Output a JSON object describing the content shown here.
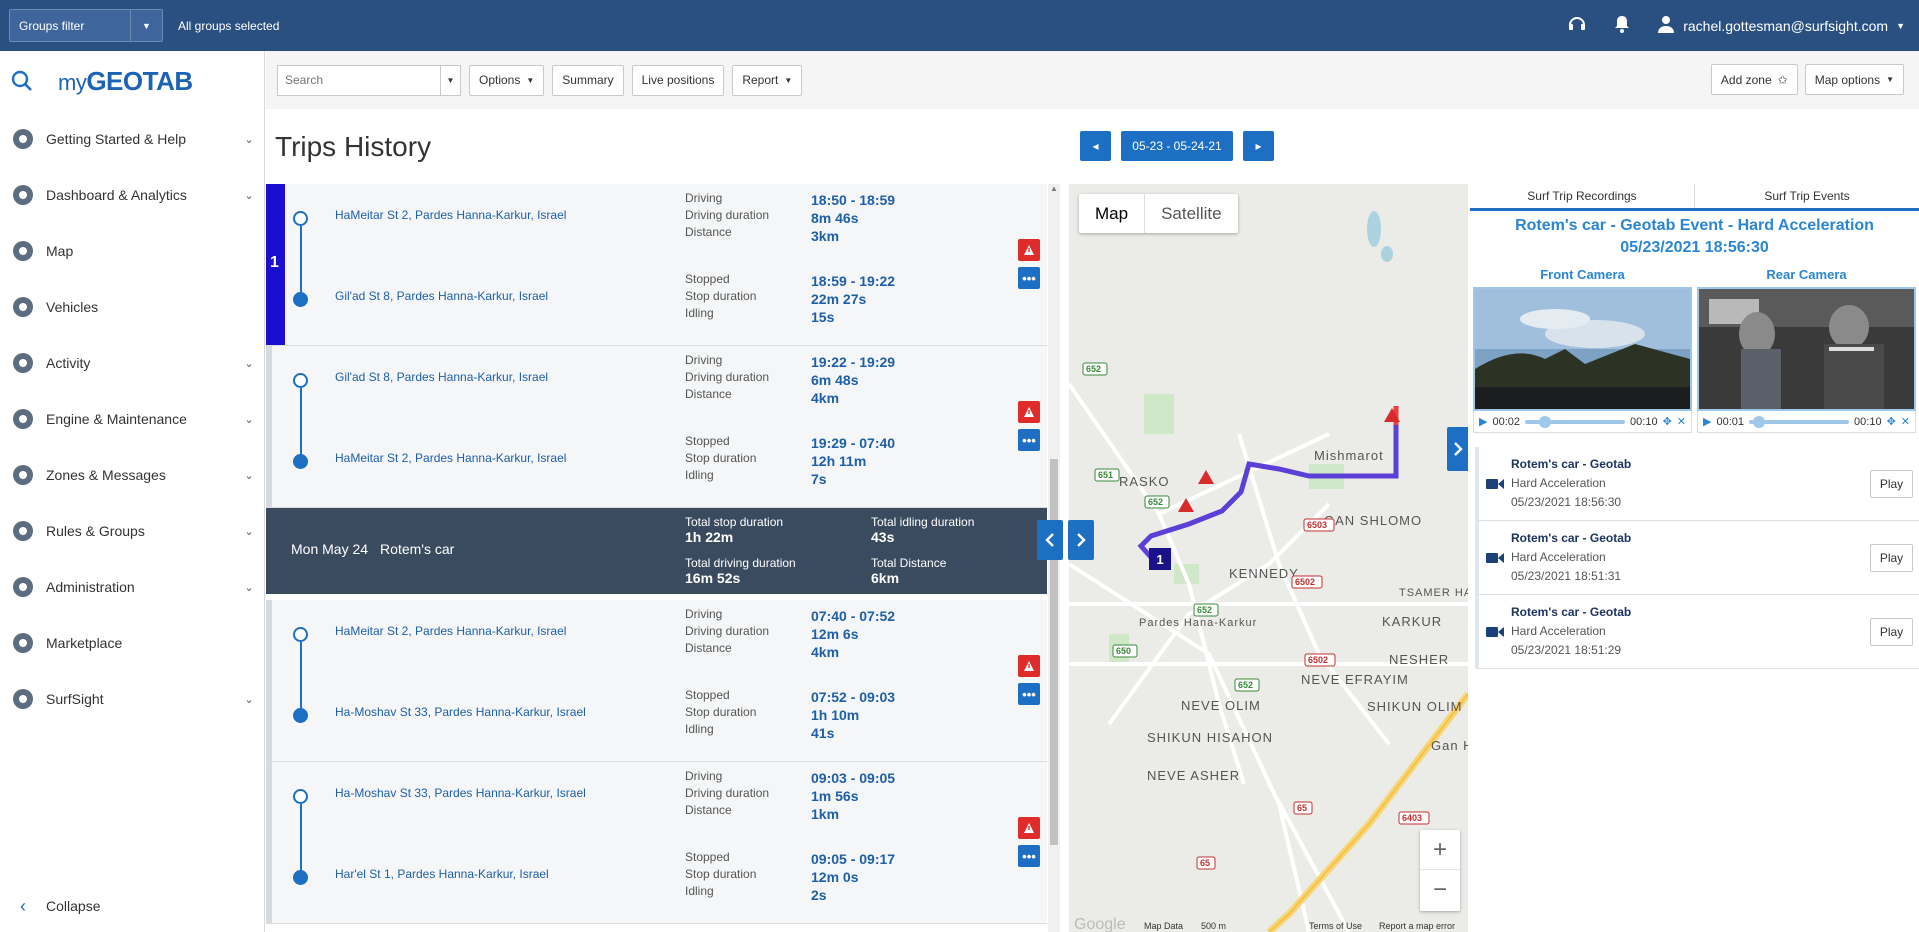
{
  "topbar": {
    "groups_filter": "Groups filter",
    "groups_selected": "All groups selected",
    "user": "rachel.gottesman@surfsight.com"
  },
  "sidebar": {
    "logo_my": "my",
    "logo_brand": "GEOTAB",
    "items": [
      {
        "label": "Getting Started & Help",
        "icon": "help-icon"
      },
      {
        "label": "Dashboard & Analytics",
        "icon": "pie-chart-icon"
      },
      {
        "label": "Map",
        "icon": "map-icon"
      },
      {
        "label": "Vehicles",
        "icon": "truck-icon"
      },
      {
        "label": "Activity",
        "icon": "bar-chart-icon"
      },
      {
        "label": "Engine & Maintenance",
        "icon": "engine-icon"
      },
      {
        "label": "Zones & Messages",
        "icon": "zones-icon"
      },
      {
        "label": "Rules & Groups",
        "icon": "rules-icon"
      },
      {
        "label": "Administration",
        "icon": "gear-icon"
      },
      {
        "label": "Marketplace",
        "icon": "marketplace-icon"
      },
      {
        "label": "SurfSight",
        "icon": "puzzle-icon"
      }
    ],
    "collapse": "Collapse"
  },
  "toolbar": {
    "search_placeholder": "Search",
    "options": "Options",
    "summary": "Summary",
    "live_positions": "Live positions",
    "report": "Report",
    "add_zone": "Add zone",
    "map_options": "Map options"
  },
  "page": {
    "title": "Trips History",
    "date_range": "05-23 - 05-24-21"
  },
  "trips": [
    {
      "number": "1",
      "from": "HaMeitar St 2, Pardes Hanna-Karkur, Israel",
      "to": "Gil'ad St 8, Pardes Hanna-Karkur, Israel",
      "k1": [
        "Driving",
        "Driving duration",
        "Distance"
      ],
      "v1": [
        "18:50 - 18:59",
        "8m 46s",
        "3km"
      ],
      "k2": [
        "Stopped",
        "Stop duration",
        "Idling"
      ],
      "v2": [
        "18:59 - 19:22",
        "22m 27s",
        "15s"
      ]
    },
    {
      "from": "Gil'ad St 8, Pardes Hanna-Karkur, Israel",
      "to": "HaMeitar St 2, Pardes Hanna-Karkur, Israel",
      "k1": [
        "Driving",
        "Driving duration",
        "Distance"
      ],
      "v1": [
        "19:22 - 19:29",
        "6m 48s",
        "4km"
      ],
      "k2": [
        "Stopped",
        "Stop duration",
        "Idling"
      ],
      "v2": [
        "19:29 - 07:40",
        "12h 11m",
        "7s"
      ]
    },
    {
      "from": "HaMeitar St 2, Pardes Hanna-Karkur, Israel",
      "to": "Ha-Moshav St 33, Pardes Hanna-Karkur, Israel",
      "k1": [
        "Driving",
        "Driving duration",
        "Distance"
      ],
      "v1": [
        "07:40 - 07:52",
        "12m 6s",
        "4km"
      ],
      "k2": [
        "Stopped",
        "Stop duration",
        "Idling"
      ],
      "v2": [
        "07:52 - 09:03",
        "1h 10m",
        "41s"
      ]
    },
    {
      "from": "Ha-Moshav St 33, Pardes Hanna-Karkur, Israel",
      "to": "Har'el St 1, Pardes Hanna-Karkur, Israel",
      "k1": [
        "Driving",
        "Driving duration",
        "Distance"
      ],
      "v1": [
        "09:03 - 09:05",
        "1m 56s",
        "1km"
      ],
      "k2": [
        "Stopped",
        "Stop duration",
        "Idling"
      ],
      "v2": [
        "09:05 - 09:17",
        "12m 0s",
        "2s"
      ]
    }
  ],
  "day_summary": {
    "date": "Mon May 24",
    "vehicle": "Rotem's car",
    "total_stop_label": "Total stop duration",
    "total_stop": "1h 22m",
    "total_idling_label": "Total idling duration",
    "total_idling": "43s",
    "total_driving_label": "Total driving duration",
    "total_driving": "16m 52s",
    "total_distance_label": "Total Distance",
    "total_distance": "6km"
  },
  "map": {
    "map_btn": "Map",
    "satellite_btn": "Satellite",
    "labels": [
      "Mishmarot",
      "RASKO",
      "GAN SHLOMO",
      "KENNEDY",
      "TSAMER HAMOSHAV",
      "KARKUR",
      "Pardes Hana-Karkur",
      "NEVE EFRAYIM",
      "NEVE OLIM",
      "SHIKUN HISAHON",
      "SHIKUN OLIM B",
      "NESHER",
      "NEVE ASHER",
      "Gan HaShomron"
    ],
    "roads": [
      "652",
      "651",
      "652",
      "6503",
      "6502",
      "652",
      "650",
      "6502",
      "652",
      "65",
      "6403",
      "65"
    ],
    "marker": "1",
    "footer": [
      "Google",
      "Map Data",
      "500 m",
      "Terms of Use",
      "Report a map error"
    ],
    "route_color": "#5b3fd6"
  },
  "right_panel": {
    "tab_recordings": "Surf Trip Recordings",
    "tab_events": "Surf Trip Events",
    "event_title": "Rotem's car - Geotab Event - Hard Acceleration",
    "event_time": "05/23/2021 18:56:30",
    "front_camera": "Front Camera",
    "rear_camera": "Rear Camera",
    "front_time": "00:02",
    "front_total": "00:10",
    "front_progress": 0.2,
    "rear_time": "00:01",
    "rear_total": "00:10",
    "rear_progress": 0.1,
    "events": [
      {
        "name": "Rotem's car - Geotab",
        "type": "Hard Acceleration",
        "time": "05/23/2021 18:56:30",
        "play": "Play"
      },
      {
        "name": "Rotem's car - Geotab",
        "type": "Hard Acceleration",
        "time": "05/23/2021 18:51:31",
        "play": "Play"
      },
      {
        "name": "Rotem's car - Geotab",
        "type": "Hard Acceleration",
        "time": "05/23/2021 18:51:29",
        "play": "Play"
      }
    ]
  }
}
